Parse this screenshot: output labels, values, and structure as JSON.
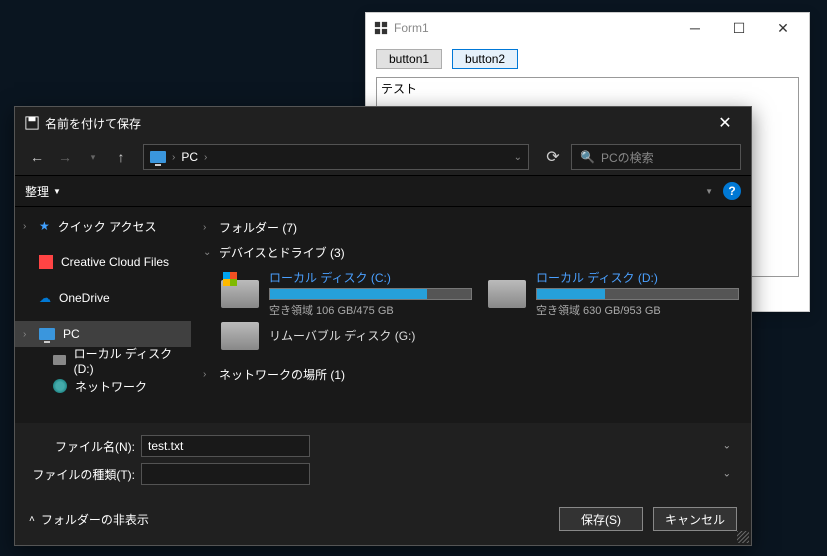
{
  "form": {
    "title": "Form1",
    "button1": "button1",
    "button2": "button2",
    "textarea_value": "テスト"
  },
  "dialog": {
    "title": "名前を付けて保存",
    "breadcrumb": {
      "root": "PC"
    },
    "search_placeholder": "PCの検索",
    "organize": "整理",
    "sidebar": {
      "quick_access": "クイック アクセス",
      "creative_cloud": "Creative Cloud Files",
      "onedrive": "OneDrive",
      "pc": "PC",
      "local_disk_d": "ローカル ディスク (D:)",
      "network": "ネットワーク"
    },
    "sections": {
      "folders": "フォルダー (7)",
      "devices": "デバイスとドライブ (3)",
      "network": "ネットワークの場所 (1)"
    },
    "drives": {
      "c": {
        "name": "ローカル ディスク (C:)",
        "free": "空き領域 106 GB/475 GB",
        "fill": 78
      },
      "d": {
        "name": "ローカル ディスク (D:)",
        "free": "空き領域 630 GB/953 GB",
        "fill": 34
      },
      "g": {
        "name": "リムーバブル ディスク (G:)"
      }
    },
    "filename_label": "ファイル名(N):",
    "filename_value": "test.txt",
    "filetype_label": "ファイルの種類(T):",
    "filetype_value": "",
    "hide_folders": "フォルダーの非表示",
    "save_btn": "保存(S)",
    "cancel_btn": "キャンセル"
  }
}
